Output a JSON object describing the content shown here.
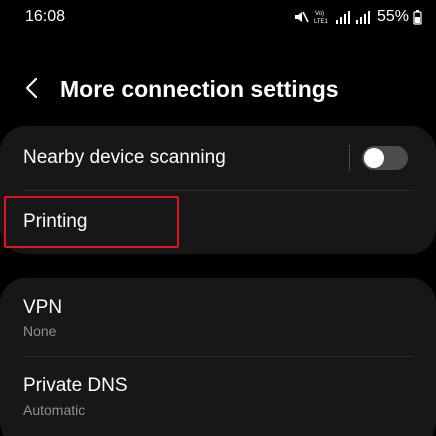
{
  "status_bar": {
    "time": "16:08",
    "network_label": "Vo) LTE1",
    "battery": "55%",
    "icons": [
      "mute-icon",
      "volte-icon",
      "signal-icon",
      "signal-icon",
      "battery-icon"
    ]
  },
  "header": {
    "back_icon": "chevron-left-icon",
    "title": "More connection settings"
  },
  "card1": {
    "nearby": {
      "label": "Nearby device scanning",
      "toggle_on": false
    },
    "printing": {
      "label": "Printing"
    }
  },
  "card2": {
    "vpn": {
      "label": "VPN",
      "value": "None"
    },
    "dns": {
      "label": "Private DNS",
      "value": "Automatic"
    }
  },
  "colors": {
    "background": "#000000",
    "card": "#171717",
    "subtext": "#8f8f8f",
    "highlight": "#e0121a",
    "toggle_off": "#4d4d4d"
  }
}
